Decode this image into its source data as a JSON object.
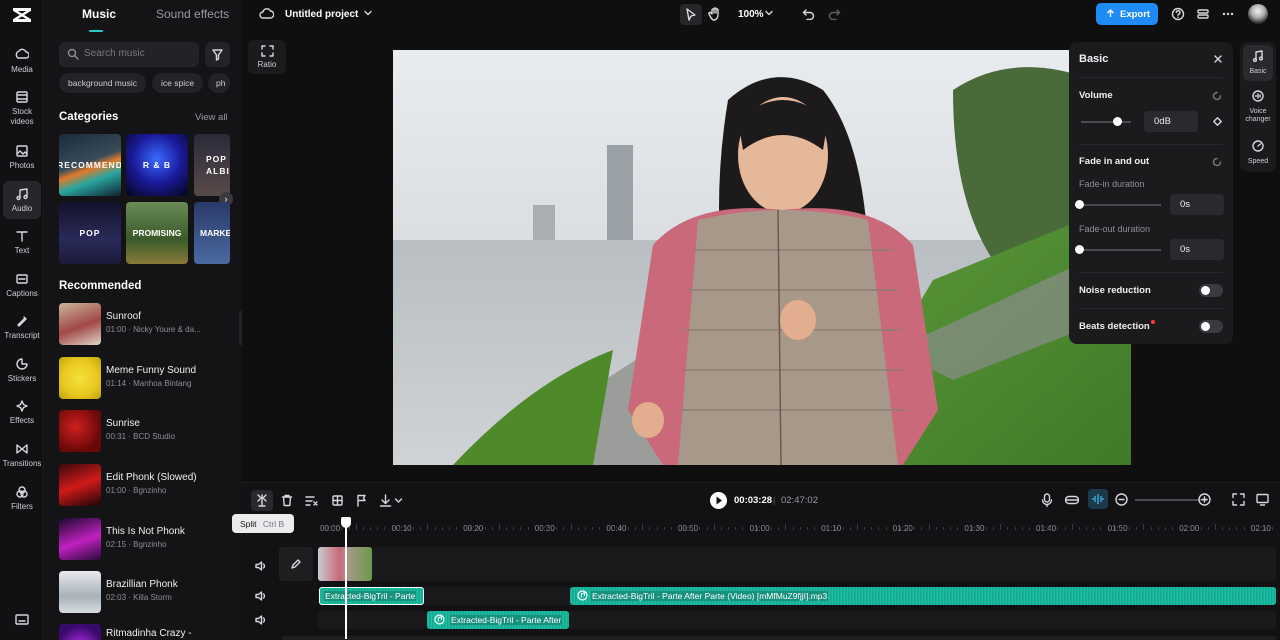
{
  "rail": {
    "items": [
      {
        "label": "Media",
        "icon": "media-icon"
      },
      {
        "label": "Stock videos",
        "icon": "stock-videos-icon"
      },
      {
        "label": "Photos",
        "icon": "photos-icon"
      },
      {
        "label": "Audio",
        "icon": "audio-icon"
      },
      {
        "label": "Text",
        "icon": "text-icon"
      },
      {
        "label": "Captions",
        "icon": "captions-icon"
      },
      {
        "label": "Transcript",
        "icon": "transcript-icon"
      },
      {
        "label": "Stickers",
        "icon": "stickers-icon"
      },
      {
        "label": "Effects",
        "icon": "effects-icon"
      },
      {
        "label": "Transitions",
        "icon": "transitions-icon"
      },
      {
        "label": "Filters",
        "icon": "filters-icon"
      }
    ]
  },
  "panel": {
    "tabs": [
      "Music",
      "Sound effects"
    ],
    "search_placeholder": "Search music",
    "chips": [
      "background music",
      "ice spice",
      "ph"
    ],
    "categories_title": "Categories",
    "view_all": "View all",
    "categories": [
      "RECOMMEND",
      "R & B",
      "POP ALBI",
      "POP",
      "PROMISING",
      "MARKE"
    ],
    "recommended_title": "Recommended",
    "recommended": [
      {
        "title": "Sunroof",
        "sub": "01:00 · Nicky Youre & da..."
      },
      {
        "title": "Meme Funny Sound",
        "sub": "01:14 · Manhoa Bintang"
      },
      {
        "title": "Sunrise",
        "sub": "00:31 · BCD Studio"
      },
      {
        "title": "Edit Phonk (Slowed)",
        "sub": "01:00 · Bgnzinho"
      },
      {
        "title": "This Is Not Phonk",
        "sub": "02:15 · Bgnzinho"
      },
      {
        "title": "Brazillian Phonk",
        "sub": "02:03 · Killa Storm"
      },
      {
        "title": "Ritmadinha Crazy -",
        "sub": ""
      }
    ]
  },
  "topbar": {
    "project_title": "Untitled project",
    "zoom": "100%",
    "export_label": "Export"
  },
  "canvas": {
    "ratio_label": "Ratio"
  },
  "props": {
    "title": "Basic",
    "volume_label": "Volume",
    "volume_value": "0dB",
    "volume_level": 0.72,
    "fade_label": "Fade in and out",
    "fade_in_label": "Fade-in duration",
    "fade_in_value": "0s",
    "fade_out_label": "Fade-out duration",
    "fade_out_value": "0s",
    "noise_label": "Noise reduction",
    "beats_label": "Beats detection"
  },
  "rtabs": [
    "Basic",
    "Voice changer",
    "Speed"
  ],
  "timeline": {
    "current_time": "00:03:28",
    "total_time": "02:47:02",
    "split_tooltip": "Split",
    "split_shortcut": "Ctrl B",
    "ticks": [
      "00:00",
      "00:10",
      "00:20",
      "00:30",
      "00:40",
      "00:50",
      "01:00",
      "01:10",
      "01:20",
      "01:30",
      "01:40",
      "01:50",
      "02:00",
      "02:10"
    ],
    "clip_a": "Extracted-BigTril - Parte",
    "clip_b": "Extracted-BigTril - Parte After Parte (Video) [mMfMuZ9fjjI].mp3",
    "clip_c": "Extracted-BigTril - Parte After"
  },
  "colors": {
    "accent": "#1f8bf4",
    "audio": "#17b89d",
    "bg": "#0f0f10"
  }
}
